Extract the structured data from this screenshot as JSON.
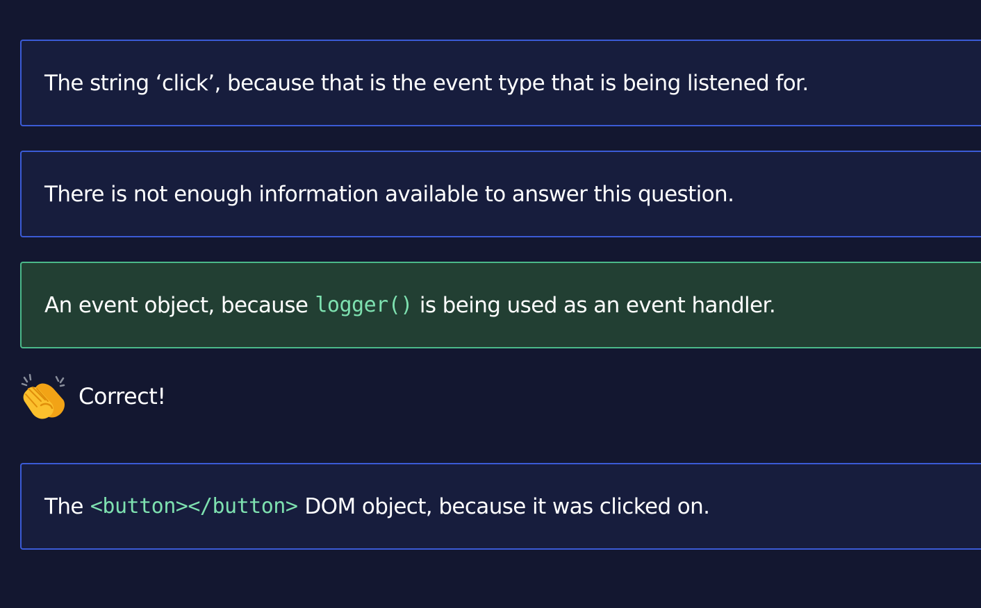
{
  "options": [
    {
      "text": "The string ‘click’, because that is the event type that is being listened for."
    },
    {
      "text": "There is not enough information available to answer this question."
    },
    {
      "text_before": "An event object, because",
      "code": "logger()",
      "text_after": "is being used as an event handler.",
      "state": "correct"
    },
    {
      "text_before": "The",
      "code": "<button></button>",
      "text_after": "DOM object, because it was clicked on."
    }
  ],
  "feedback": {
    "icon": "clapping-hands-icon",
    "text": "Correct!"
  },
  "colors": {
    "background": "#131730",
    "option_background": "#171d3d",
    "option_border": "#3b5bd6",
    "correct_background": "#223f33",
    "correct_border": "#4bb98a",
    "code_text": "#7ee1b0"
  }
}
